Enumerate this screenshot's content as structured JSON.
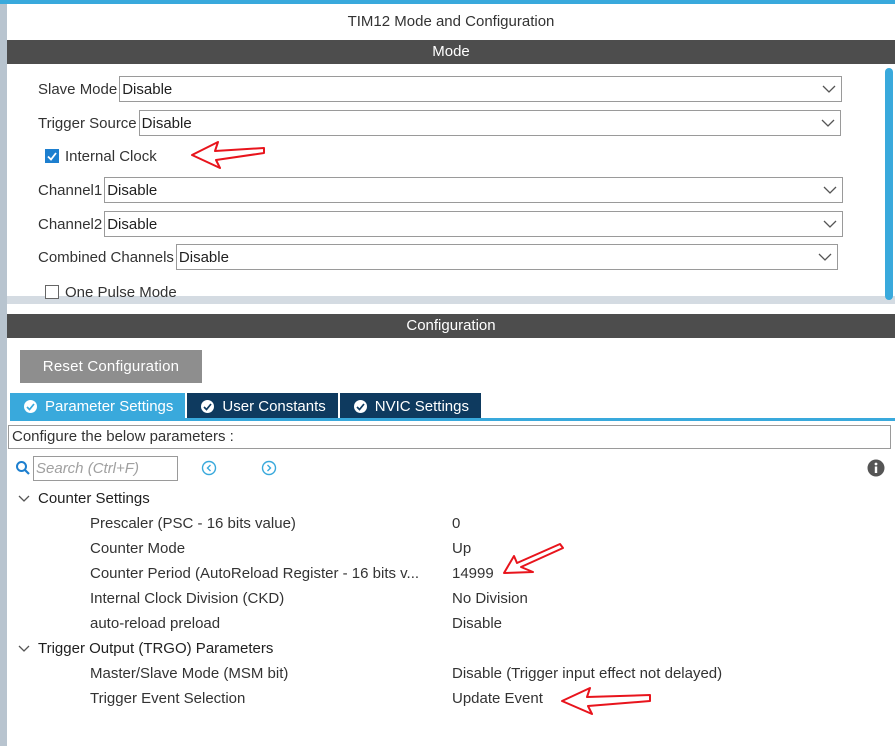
{
  "window": {
    "title": "TIM12 Mode and Configuration"
  },
  "mode": {
    "header": "Mode",
    "slave_mode": {
      "label": "Slave Mode",
      "value": "Disable"
    },
    "trigger_source": {
      "label": "Trigger Source",
      "value": "Disable"
    },
    "internal_clock": {
      "label": "Internal Clock",
      "checked": true
    },
    "channel1": {
      "label": "Channel1",
      "value": "Disable"
    },
    "channel2": {
      "label": "Channel2",
      "value": "Disable"
    },
    "combined_channels": {
      "label": "Combined Channels",
      "value": "Disable"
    },
    "one_pulse_mode": {
      "label": "One Pulse Mode",
      "checked": false
    }
  },
  "configuration": {
    "header": "Configuration",
    "reset_label": "Reset Configuration",
    "tabs": [
      {
        "label": "Parameter Settings",
        "active": true
      },
      {
        "label": "User Constants",
        "active": false
      },
      {
        "label": "NVIC Settings",
        "active": false
      }
    ],
    "description": "Configure the below parameters :",
    "search": {
      "placeholder": "Search (Ctrl+F)"
    },
    "groups": [
      {
        "label": "Counter Settings",
        "params": [
          {
            "name": "Prescaler (PSC - 16 bits value)",
            "value": "0"
          },
          {
            "name": "Counter Mode",
            "value": "Up"
          },
          {
            "name": "Counter Period (AutoReload Register - 16 bits v...",
            "value": "14999"
          },
          {
            "name": "Internal Clock Division (CKD)",
            "value": "No Division"
          },
          {
            "name": "auto-reload preload",
            "value": "Disable"
          }
        ]
      },
      {
        "label": "Trigger Output (TRGO) Parameters",
        "params": [
          {
            "name": "Master/Slave Mode (MSM bit)",
            "value": "Disable (Trigger input effect not delayed)"
          },
          {
            "name": "Trigger Event Selection",
            "value": "Update Event"
          }
        ]
      }
    ]
  },
  "colors": {
    "accent": "#39a9dc",
    "header_bg": "#4d4d4d",
    "tab_inactive": "#0e3a5f",
    "button_bg": "#8e8e8e",
    "annotation_red": "#e8141c"
  },
  "icons": [
    "chevron-down-icon",
    "checkmark-icon",
    "search-icon",
    "previous-icon",
    "next-icon",
    "info-icon",
    "expand-icon",
    "red-arrow-annotation"
  ]
}
